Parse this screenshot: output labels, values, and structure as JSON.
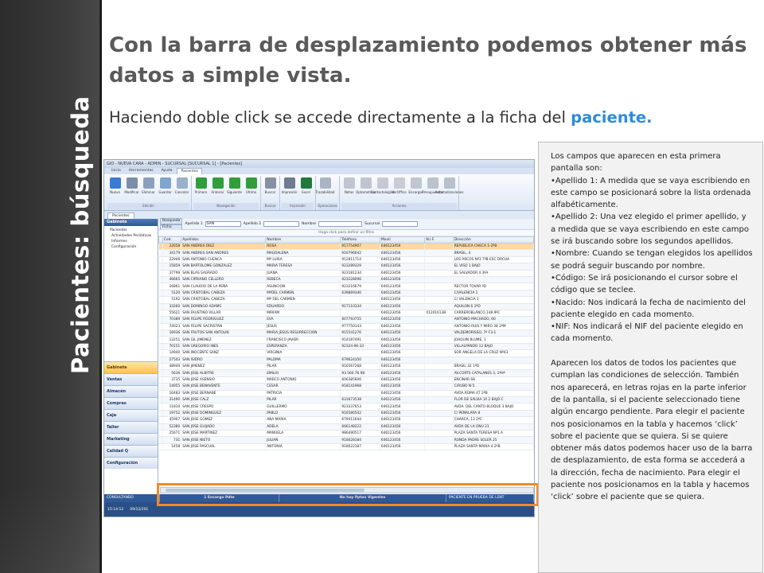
{
  "side_title": "Pacientes: búsqueda",
  "title": "Con la barra de desplazamiento podemos obtener más datos a simple vista.",
  "subtitle": {
    "text": "Haciendo doble click se accede directamente a la ficha del",
    "highlight": "paciente."
  },
  "app": {
    "window_title": "GIO - NUEVA CARA - ADMIN - SUCURSAL [SUCURSAL 1] - [Pacientes]",
    "ribbon_tabs": [
      "Inicio",
      "Herramientas",
      "Ayuda",
      "Pacientes"
    ],
    "active_ribbon_tab": "Pacientes",
    "ribbon_groups": [
      {
        "name": "Edición",
        "buttons": [
          "Nuevo",
          "Modificar",
          "Eliminar",
          "Guardar",
          "Cancelar"
        ]
      },
      {
        "name": "Navegación",
        "buttons": [
          "Primero",
          "Anterior",
          "Siguiente",
          "Último"
        ]
      },
      {
        "name": "Buscar",
        "buttons": [
          "Buscar"
        ]
      },
      {
        "name": "Impresión",
        "buttons": [
          "Impresión",
          "Excel"
        ]
      },
      {
        "name": "Operaciones",
        "buttons": [
          "Trazabilidad"
        ]
      },
      {
        "name": "Acciones",
        "buttons": [
          "Notas",
          "Optometrías",
          "Contactologías",
          "VerOffice",
          "Encargos",
          "Presupuestos",
          "Automatizaciones"
        ]
      }
    ],
    "content_tab": "Pacientes",
    "nav_header": "Gabinete",
    "tree_items": [
      "Pacientes",
      "Actividades Periódicas",
      "Informes",
      "Configuración"
    ],
    "nav_buttons": [
      "Gabinete",
      "Ventas",
      "Almacén",
      "Compras",
      "Caja",
      "Taller",
      "Marketing",
      "Calidad Q",
      "Configuración"
    ],
    "active_nav": "Gabinete",
    "search_tags": [
      "Búsqueda",
      "Ficha"
    ],
    "search_fields": [
      {
        "label": "Apellido 1",
        "value": "SAN"
      },
      {
        "label": "Apellido 2",
        "value": ""
      },
      {
        "label": "Nombre",
        "value": ""
      },
      {
        "label": "Sucursal",
        "value": ""
      }
    ],
    "filter_hint": "Haga click para definir un filtro",
    "grid_columns": [
      "",
      "Cod.",
      "Apellidos",
      "Nombre",
      "Teléfono",
      "Movil",
      "N.I.F.",
      "Dirección"
    ],
    "grid_rows": [
      [
        "",
        "22658",
        "SAN ANDRES DIEZ",
        "ROSA",
        "917754907",
        "646123456",
        "",
        "REPUBLICA CHECA 1-2ºB"
      ],
      [
        "",
        "34179",
        "SAN ANDRES SAN ANDRES",
        "MAGDALENA",
        "916796642",
        "646123456",
        "",
        "BRASIL, 4"
      ],
      [
        "",
        "22946",
        "SAN ANTONIO CUENCA",
        "Mª LUISA",
        "912811714",
        "646123456",
        "",
        "LOS ARCOS Nº3 7ºB ESC DRCHA"
      ],
      [
        "",
        "15859",
        "SAN BARTOLOME GONZALEZ",
        "MARIA TERESA",
        "923289329",
        "646123456",
        "",
        "EL VISO 1 BAJO"
      ],
      [
        "",
        "37799",
        "SAN BLAS SAGRADO",
        "JUANA",
        "923181234",
        "646123456",
        "",
        "EL SALVADOR 4 3ºA"
      ],
      [
        "",
        "46665",
        "SAN CIPRIANO CELLERO",
        "REBECA",
        "923228096",
        "646123456",
        "",
        ""
      ],
      [
        "",
        "26861",
        "SAN CLAUDIO DE LA PEÑA",
        "ASUNCION",
        "923216679",
        "646123456",
        "",
        "RECTOR TOVAR ºD"
      ],
      [
        "",
        "5120",
        "SAN CRISTOBAL CABEZA",
        "MªDEL CARMEN",
        "639869340",
        "646123456",
        "",
        "C/VALENCIA 1"
      ],
      [
        "",
        "5192",
        "SAN CRISTOBAL CABEZA",
        "Mª DEL CARMEN",
        "",
        "646123456",
        "",
        "C/ VALENCIA 1"
      ],
      [
        "",
        "33260",
        "SAN DOMINGO ADAMS",
        "EDUARDO",
        "917110334",
        "646123456",
        "",
        "AQUILON 6 2ºD"
      ],
      [
        "",
        "55621",
        "SAN FAUSTINO VILLAR",
        "MIRIAM",
        "",
        "646123456",
        "01201613B",
        "CARREROBLANCO,148 9ºC"
      ],
      [
        "",
        "70389",
        "SAN FELIPE RODRIGUEZ",
        "EVA",
        "607793755",
        "646123456",
        "",
        "ANTONIO MACHADO, 60"
      ],
      [
        "",
        "74023",
        "SAN FELIPE SACRISTAN",
        "JESUS",
        "977750143",
        "646123456",
        "",
        "ANTONIO RUIS Y MIRO 38 2ºM"
      ],
      [
        "",
        "16936",
        "SAN FRUTOS SAN ANTOLIN",
        "MARIA JESUS RESURRECCION",
        "915541276",
        "646123456",
        "",
        "VALDEMORISSO, 7º F3-1"
      ],
      [
        "",
        "13251",
        "SAN GIL JIMENEZ",
        "FRANCISCO JAVIER",
        "914187491",
        "646123456",
        "",
        "JOAQUIN BLUME, 1"
      ],
      [
        "",
        "70151",
        "SAN GREGORIO INES",
        "ESPERANZA",
        "92324-96-33",
        "646123456",
        "",
        "VILLALPANDO 12 BAJO"
      ],
      [
        "",
        "14940",
        "SAN INOCENTE SANZ",
        "VIRGINIA",
        "",
        "646123456",
        "",
        "SOR ANGELA DE LA CRUZ Nº43"
      ],
      [
        "",
        "27503",
        "SAN ISIDRO",
        "PALOMA",
        "679624350",
        "646123456",
        "",
        ""
      ],
      [
        "",
        "48949",
        "SAN JIMENEZ",
        "PILAR",
        "916567268",
        "646123456",
        "",
        "BRASIL 32 1ºD"
      ],
      [
        "",
        "5636",
        "SAN JOSE ALBITRE",
        "EMILIO",
        "93.560.76.98",
        "646123456",
        "",
        "AV.CORTS CATALANES 3, 1ºHº"
      ],
      [
        "",
        "3735",
        "SAN JOSE ASENSIO",
        "MARCO ANTONIO",
        "606385606",
        "646123456",
        "",
        "ENCINAR 68"
      ],
      [
        "",
        "14955",
        "SAN JOSE BENAVENTE",
        "CESAR",
        "918141968",
        "646123456",
        "",
        "C/RUBO N-5"
      ],
      [
        "",
        "16483",
        "SAN JOSE BERNABÉ",
        "PATRICIA",
        "",
        "646123456",
        "",
        "AVDA.ROMA 47 2ºB"
      ],
      [
        "",
        "31490",
        "SAN JOSE CALZ",
        "PILAR",
        "631673538",
        "646123456",
        "",
        "FLOR DE SALVIA 10 2 BAJO C"
      ],
      [
        "",
        "11810",
        "SAN JOSE CRESPO",
        "GUILLERMO",
        "923337653",
        "646123456",
        "",
        "AVDA. DEL CANTO BLOQUE 3 BAJO"
      ],
      [
        "",
        "19752",
        "SAN JOSE DOMINGUEZ",
        "PABLO",
        "916580542",
        "646123456",
        "",
        "C/ PEÑALARA 8"
      ],
      [
        "",
        "45907",
        "SAN JOSE GOMEZ",
        "ANA MARIA",
        "679411644",
        "646123456",
        "",
        "CHARCA, 13 2ºC"
      ],
      [
        "",
        "52380",
        "SAN JOSE GUIJADO",
        "ADELA",
        "666148222",
        "646123456",
        "",
        "AVDA DE LA ONU 21"
      ],
      [
        "",
        "25671",
        "SAN JOSE MARTINEZ",
        "MANUELA",
        "986490517",
        "646123456",
        "",
        "PLAZA SANTA TERESA Nº1 A"
      ],
      [
        "",
        "731",
        "SAN JOSE NIETO",
        "JULIAN",
        "918028184",
        "646123456",
        "",
        "RONDA PADRE SOLER 25"
      ],
      [
        "",
        "1458",
        "SAN JOSE PASCUAL",
        "ANTONIA",
        "918022187",
        "646123456",
        "",
        "PLAZA SANTA MARIA 4 2ºB"
      ]
    ],
    "selected_row": 0,
    "status": [
      "CONSULTANDO",
      "1 Encargo Pdte",
      "No hay Pptos Vigentes",
      "PACIENTE EN PRUEBA DE LENT"
    ],
    "bottom": [
      "15:14:12",
      "09/12/201"
    ]
  },
  "description": [
    "Los campos que aparecen en esta primera pantalla son:",
    "•Apellido 1: A medida que se vaya escribiendo en este campo se posicionará sobre la lista ordenada alfabéticamente.",
    "•Apellido 2: Una vez elegido el primer apellido, y a medida que se vaya escribiendo en este campo se irá buscando sobre los segundos apellidos.",
    "•Nombre: Cuando se tengan elegidos los apellidos se podrá seguir buscando por nombre.",
    "•Código: Se irá posicionando el cursor sobre el código que se teclee.",
    "•Nacido: Nos indicará la fecha de nacimiento del paciente elegido en cada momento.",
    "•NIF: Nos indicará el NIF del paciente elegido en cada momento.",
    "",
    "Aparecen los datos de todos los pacientes que cumplan las condiciones de selección. También nos aparecerá, en letras rojas en la parte inferior de la pantalla, si el paciente seleccionado tiene algún encargo pendiente. Para elegir el paciente nos posicionamos en la tabla y hacemos ‘click’ sobre el paciente que se quiera. Si se quiere obtener más datos podemos hacer uso de la barra de desplazamiento, de esta forma se accederá a la dirección, fecha de nacimiento. Para elegir el paciente nos posicionamos en la tabla y hacemos ‘click’ sobre el paciente que se quiera."
  ],
  "colors": {
    "sidebar": "#333333",
    "title": "#5a5a5a",
    "highlight": "#2e8bd8",
    "orange_box": "#f08a2e"
  }
}
